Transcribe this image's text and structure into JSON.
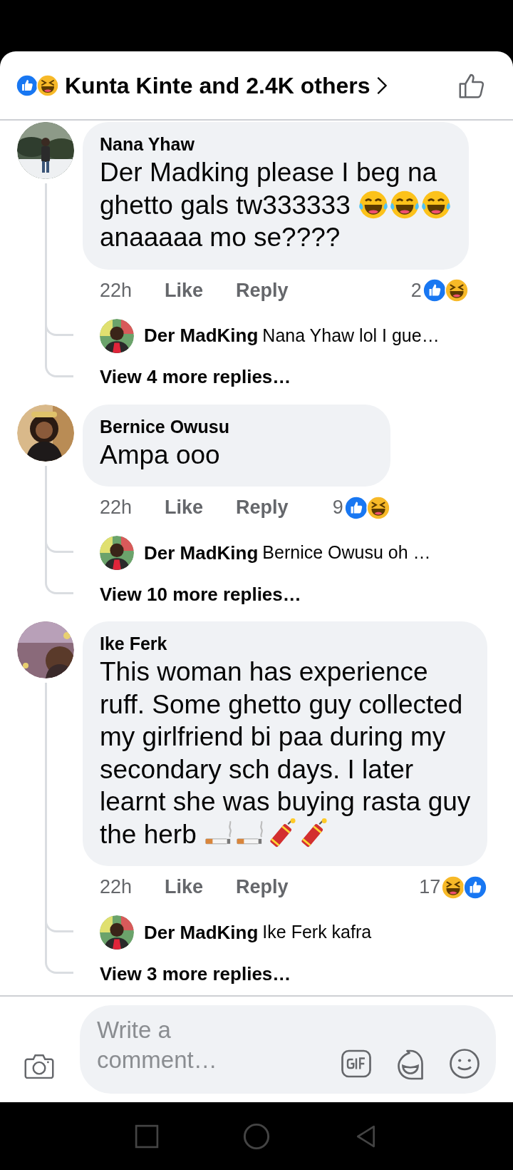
{
  "header": {
    "reactions": [
      {
        "kind": "like"
      },
      {
        "kind": "haha"
      }
    ],
    "title": "Kunta Kinte and 2.4K others"
  },
  "comments": [
    {
      "author": "Nana Yhaw",
      "lines": [
        [
          {
            "kind": "text",
            "text": "Der Madking please I beg na"
          }
        ],
        [
          {
            "kind": "text",
            "text": "ghetto gals tw333333"
          },
          {
            "kind": "laugh_tears"
          },
          {
            "kind": "laugh_tears"
          },
          {
            "kind": "laugh_tears"
          }
        ],
        [
          {
            "kind": "text",
            "text": "anaaaaa mo se????"
          }
        ]
      ],
      "time": "22h",
      "like": "Like",
      "reply": "Reply",
      "reaction_count": "2",
      "reactions": [
        {
          "kind": "like"
        },
        {
          "kind": "haha"
        }
      ],
      "replies": [
        {
          "author": "Der MadKing",
          "text": "Nana Yhaw lol I gue…"
        }
      ],
      "more": "View 4 more replies…"
    },
    {
      "author": "Bernice Owusu",
      "lines": [
        [
          {
            "kind": "text",
            "text": "Ampa ooo"
          }
        ]
      ],
      "time": "22h",
      "like": "Like",
      "reply": "Reply",
      "reaction_count": "9",
      "reactions": [
        {
          "kind": "like"
        },
        {
          "kind": "haha"
        }
      ],
      "replies": [
        {
          "author": "Der MadKing",
          "text": "Bernice Owusu oh …"
        }
      ],
      "more": "View 10 more replies…"
    },
    {
      "author": "Ike Ferk",
      "lines": [
        [
          {
            "kind": "text",
            "text": "This woman has experience"
          }
        ],
        [
          {
            "kind": "text",
            "text": "ruff. Some ghetto guy collected"
          }
        ],
        [
          {
            "kind": "text",
            "text": "my girlfriend bi paa during my"
          }
        ],
        [
          {
            "kind": "text",
            "text": "secondary sch days. I later"
          }
        ],
        [
          {
            "kind": "text",
            "text": "learnt she was buying rasta guy"
          }
        ],
        [
          {
            "kind": "text",
            "text": "the herb"
          },
          {
            "kind": "cigarette"
          },
          {
            "kind": "cigarette"
          },
          {
            "kind": "firecracker"
          },
          {
            "kind": "firecracker"
          }
        ]
      ],
      "time": "22h",
      "like": "Like",
      "reply": "Reply",
      "reaction_count": "17",
      "reactions": [
        {
          "kind": "haha"
        },
        {
          "kind": "like"
        }
      ],
      "replies": [
        {
          "author": "Der MadKing",
          "text": "Ike Ferk kafra"
        }
      ],
      "more": "View 3 more replies…"
    }
  ],
  "composer": {
    "placeholder": "Write a comment…"
  }
}
